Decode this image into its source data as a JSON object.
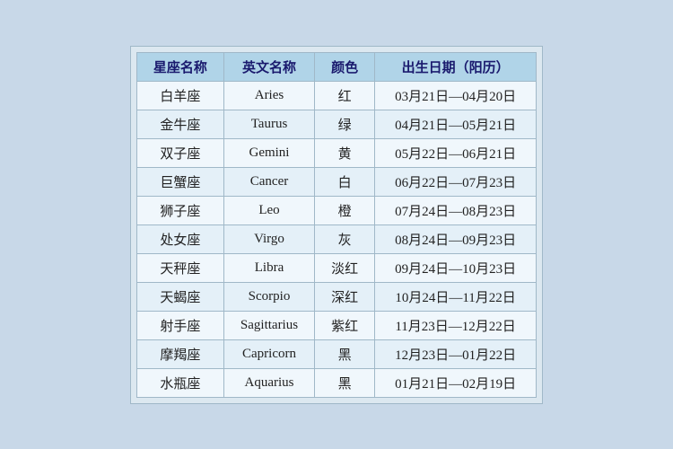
{
  "table": {
    "headers": [
      "星座名称",
      "英文名称",
      "颜色",
      "出生日期（阳历）"
    ],
    "rows": [
      {
        "chinese": "白羊座",
        "english": "Aries",
        "color": "红",
        "date": "03月21日—04月20日"
      },
      {
        "chinese": "金牛座",
        "english": "Taurus",
        "color": "绿",
        "date": "04月21日—05月21日"
      },
      {
        "chinese": "双子座",
        "english": "Gemini",
        "color": "黄",
        "date": "05月22日—06月21日"
      },
      {
        "chinese": "巨蟹座",
        "english": "Cancer",
        "color": "白",
        "date": "06月22日—07月23日"
      },
      {
        "chinese": "狮子座",
        "english": "Leo",
        "color": "橙",
        "date": "07月24日—08月23日"
      },
      {
        "chinese": "处女座",
        "english": "Virgo",
        "color": "灰",
        "date": "08月24日—09月23日"
      },
      {
        "chinese": "天秤座",
        "english": "Libra",
        "color": "淡红",
        "date": "09月24日—10月23日"
      },
      {
        "chinese": "天蝎座",
        "english": "Scorpio",
        "color": "深红",
        "date": "10月24日—11月22日"
      },
      {
        "chinese": "射手座",
        "english": "Sagittarius",
        "color": "紫红",
        "date": "11月23日—12月22日"
      },
      {
        "chinese": "摩羯座",
        "english": "Capricorn",
        "color": "黑",
        "date": "12月23日—01月22日"
      },
      {
        "chinese": "水瓶座",
        "english": "Aquarius",
        "color": "黑",
        "date": "01月21日—02月19日"
      }
    ]
  }
}
